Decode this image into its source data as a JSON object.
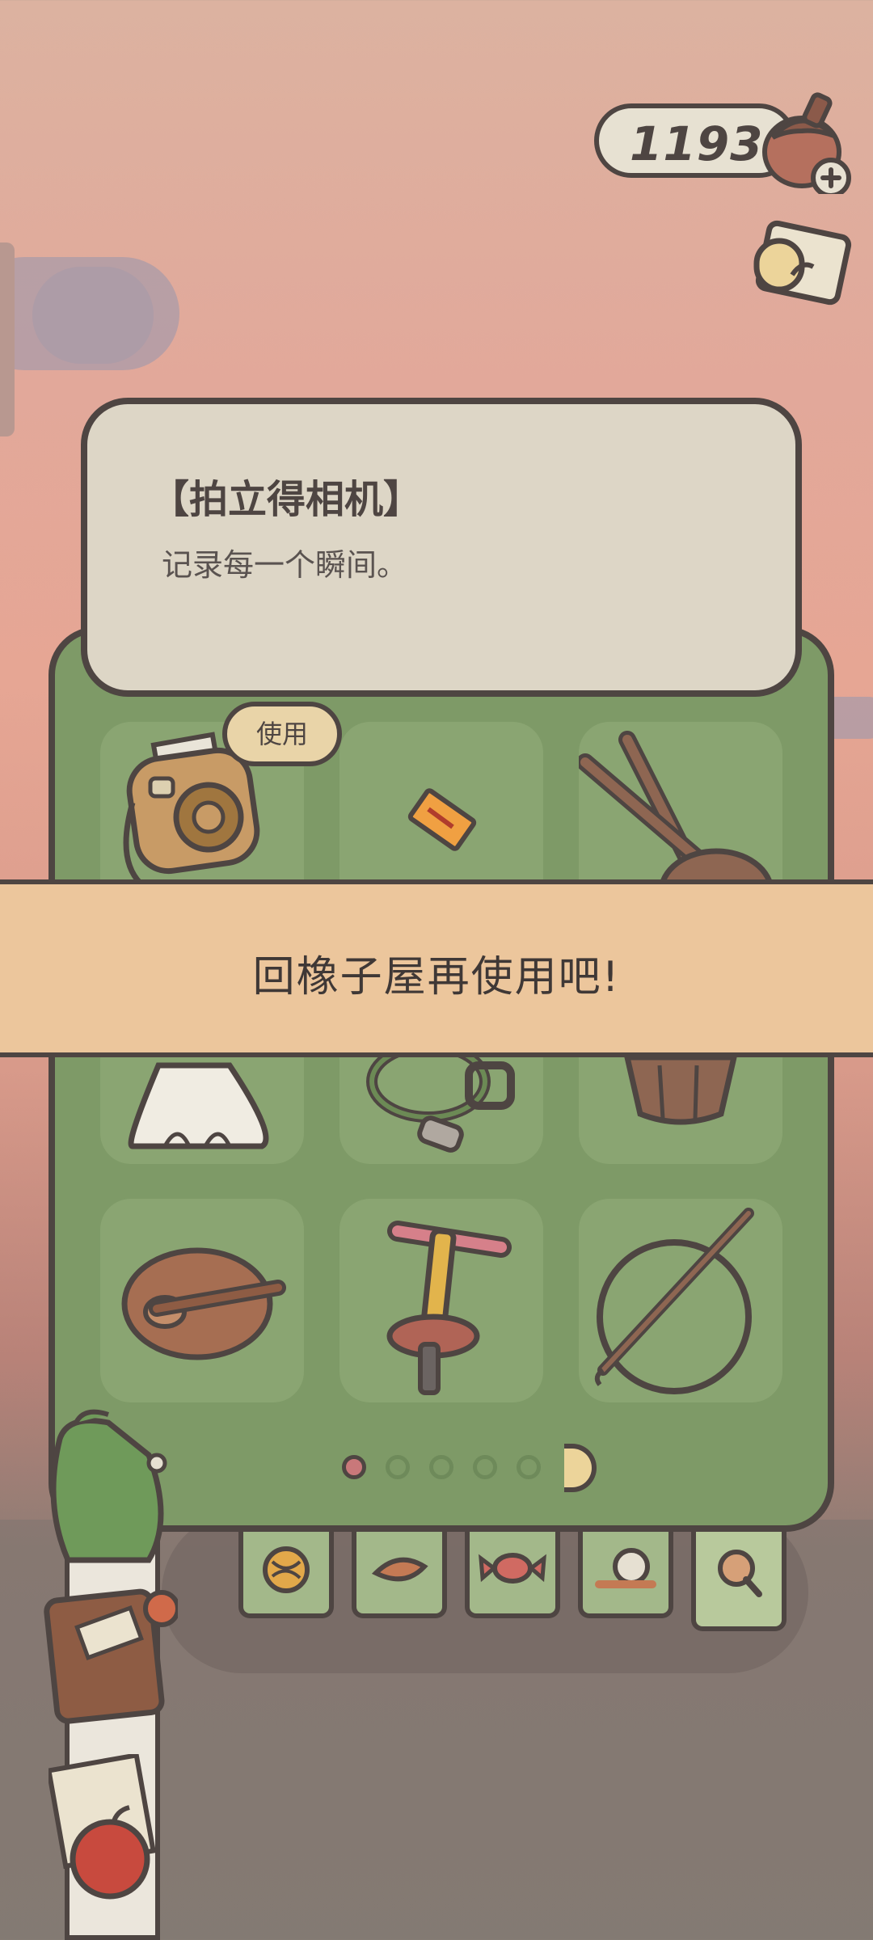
{
  "hud": {
    "acorn_count": "11934",
    "acorn_icon": "acorn-plus-icon",
    "letter_icon": "mail-letter-icon"
  },
  "item_info": {
    "title": "【拍立得相机】",
    "description": "记录每一个瞬间。"
  },
  "use_button_label": "使用",
  "toast_message": "回橡子屋再使用吧!",
  "inventory": {
    "items": [
      {
        "name": "instant-camera-icon"
      },
      {
        "name": "ticket-icon"
      },
      {
        "name": "fishing-net-icon"
      },
      {
        "name": "teru-teru-bozu-icon"
      },
      {
        "name": "rope-harness-icon"
      },
      {
        "name": "wooden-bucket-icon"
      },
      {
        "name": "roast-chicken-icon"
      },
      {
        "name": "pogo-stick-icon"
      },
      {
        "name": "hoop-icon"
      }
    ],
    "pages": 5,
    "current_page": 1
  },
  "category_tabs": [
    {
      "name": "yarn-ball-icon"
    },
    {
      "name": "leaf-icon"
    },
    {
      "name": "candy-icon"
    },
    {
      "name": "snail-icon"
    },
    {
      "name": "magnifier-icon",
      "selected": true
    }
  ],
  "colors": {
    "panel_green": "#7e9a67",
    "banner": "#ecc69c",
    "outline": "#4e4542",
    "popup": "#ddd6c6"
  }
}
